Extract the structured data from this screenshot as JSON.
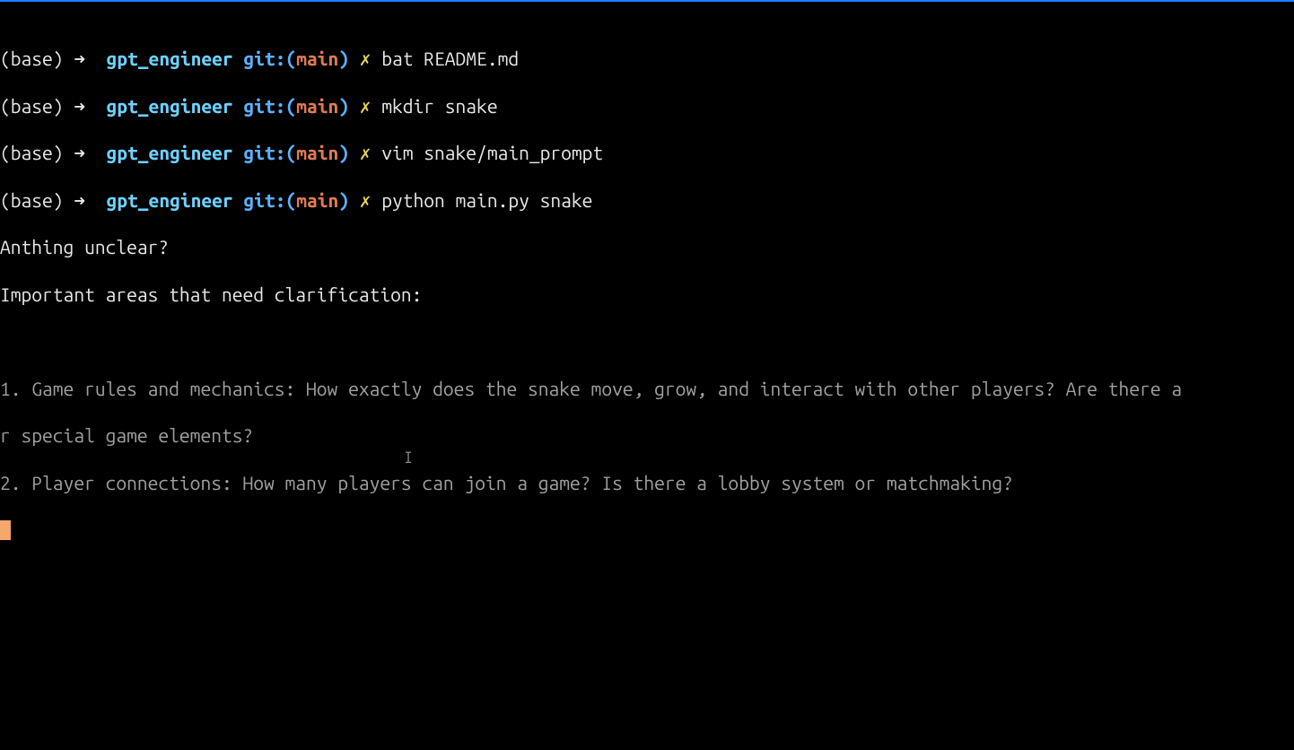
{
  "prompt": {
    "env": "(base)",
    "arrow": "➜",
    "dir": "gpt_engineer",
    "git_label": "git:(",
    "branch": "main",
    "git_close": ")",
    "dirty": "✗"
  },
  "history": [
    {
      "command": "bat README.md"
    },
    {
      "command": "mkdir snake"
    },
    {
      "command": "vim snake/main_prompt"
    },
    {
      "command": "python main.py snake"
    }
  ],
  "output": {
    "line1": "Anthing unclear?",
    "line2": "Important areas that need clarification:",
    "item1a": "1. Game rules and mechanics: How exactly does the snake move, grow, and interact with other players? Are there a",
    "item1b": "r special game elements?",
    "item2": "2. Player connections: How many players can join a game? Is there a lobby system or matchmaking?"
  },
  "text_cursor_glyph": "I"
}
